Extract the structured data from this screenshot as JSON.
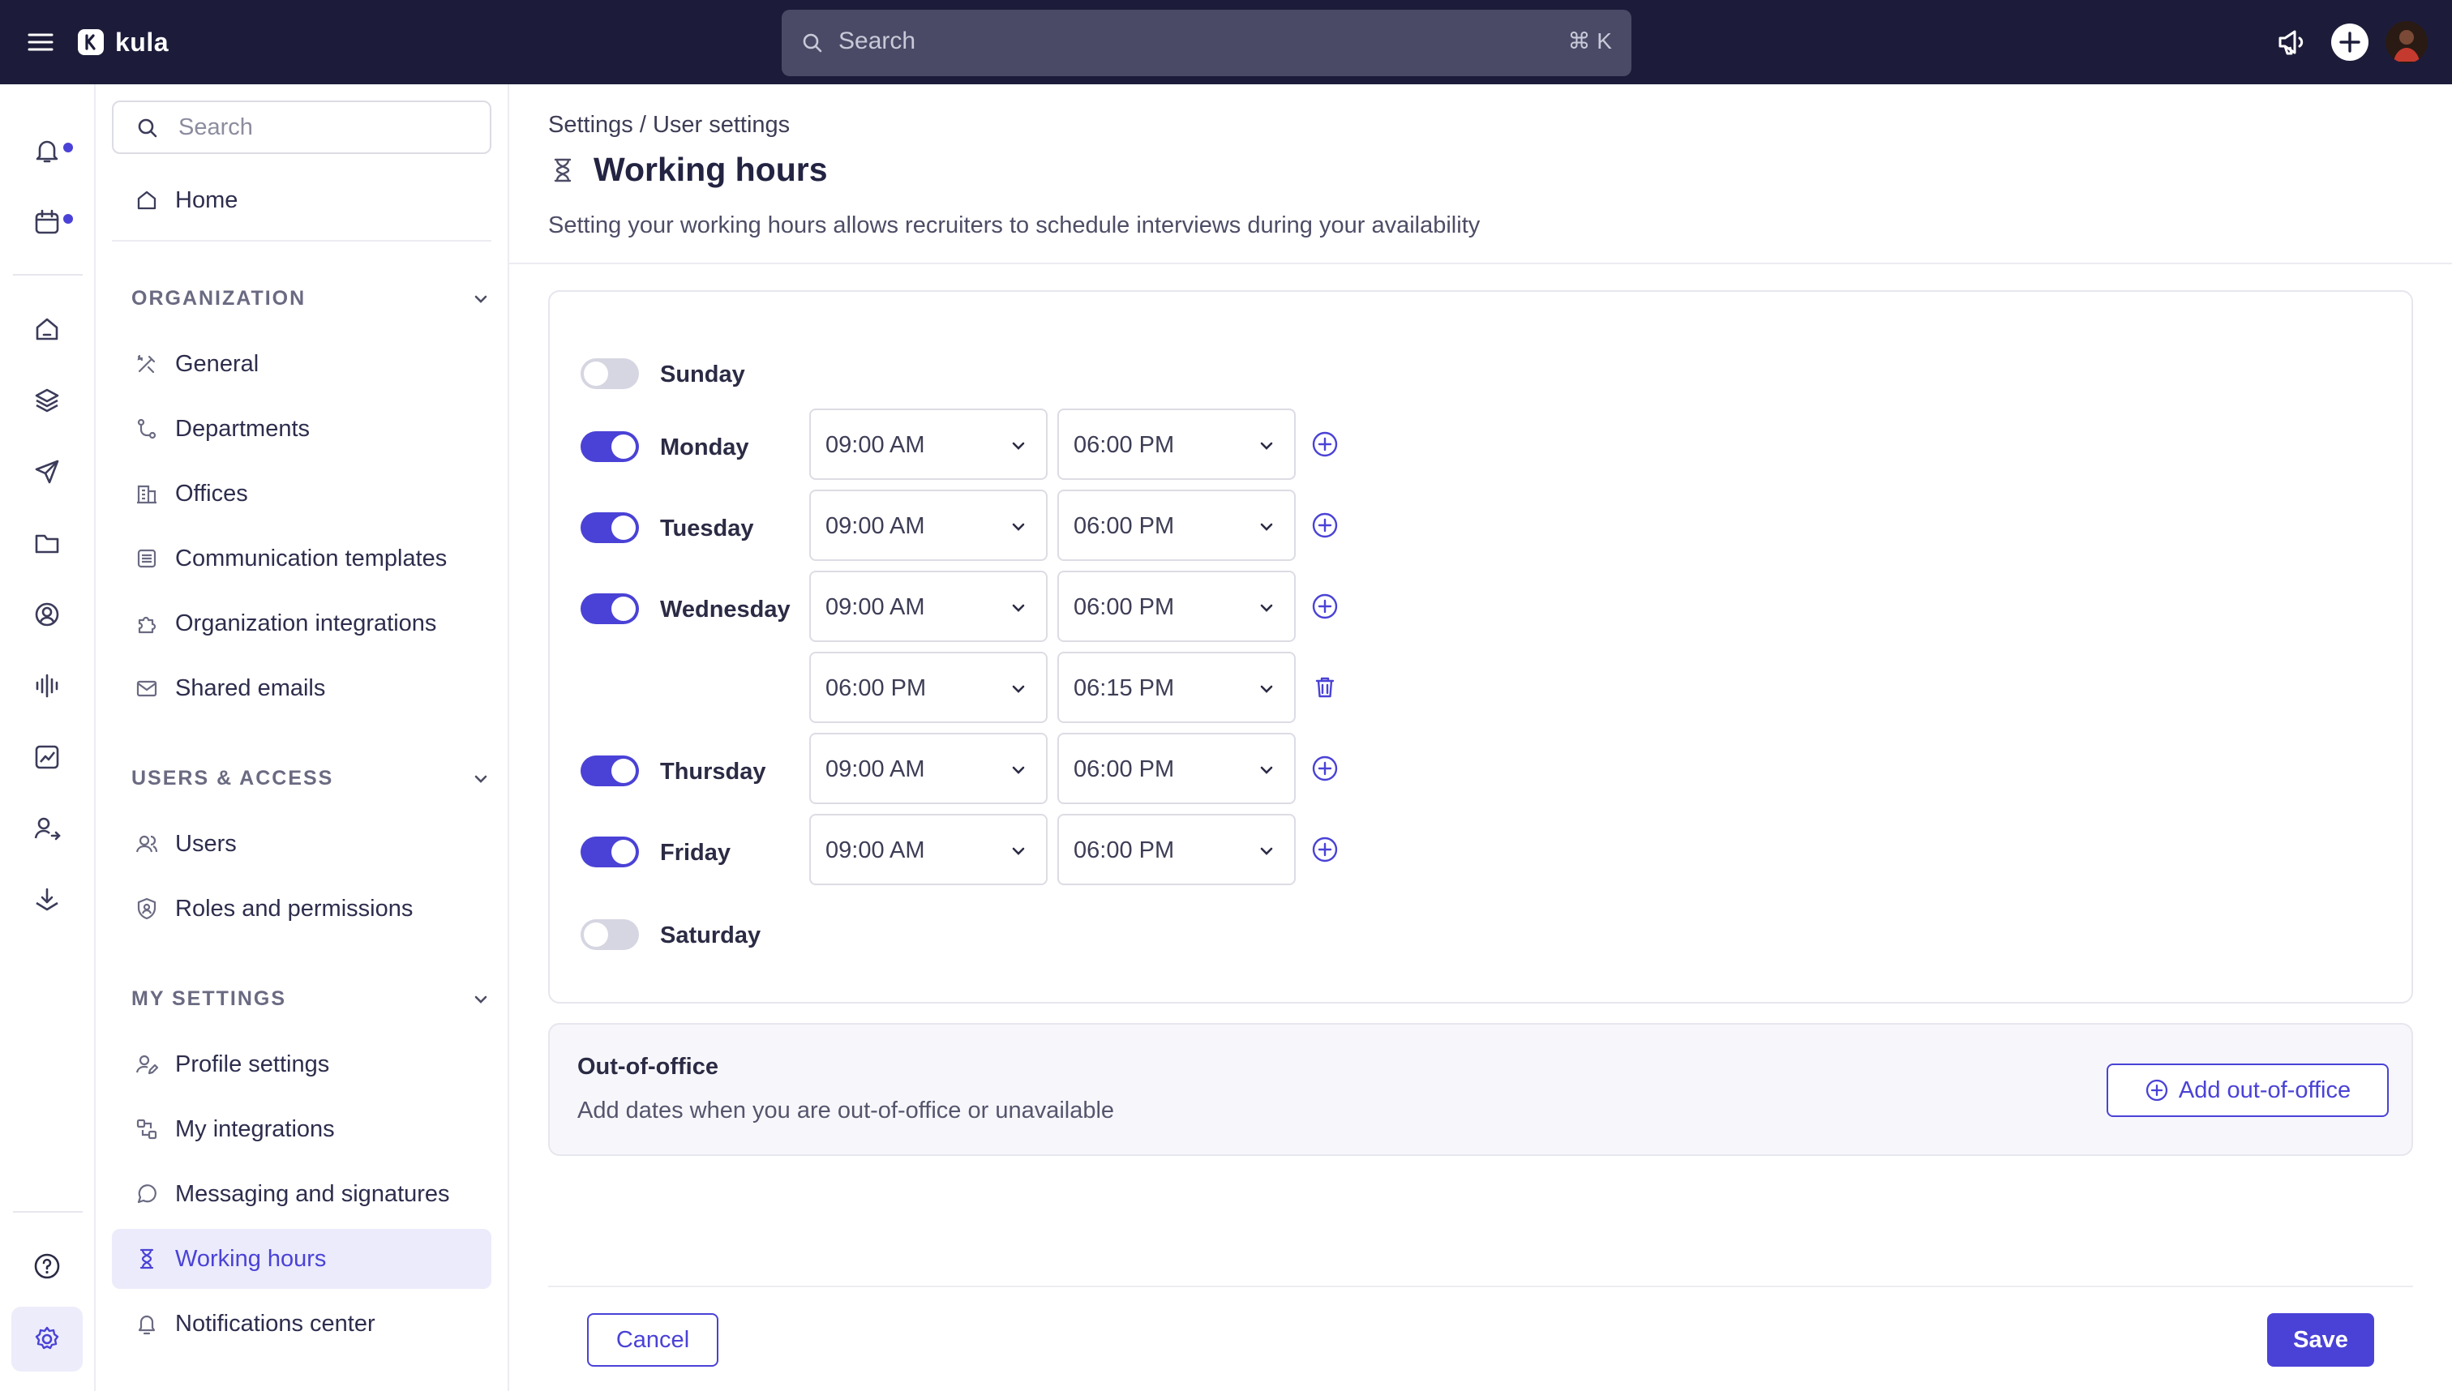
{
  "app": {
    "name": "kula"
  },
  "topbar": {
    "search_placeholder": "Search",
    "search_shortcut": "⌘ K"
  },
  "colors": {
    "accent": "#4a42d6",
    "topbar": "#1c1c3a",
    "active_bg": "#ebebfb"
  },
  "rail": {
    "icons": [
      "bell-icon",
      "calendar-icon",
      "home-icon",
      "layers-icon",
      "send-icon",
      "folder-icon",
      "user-circle-icon",
      "audio-wave-icon",
      "chart-icon",
      "users-arrow-icon",
      "download-icon",
      "help-icon",
      "gear-icon"
    ]
  },
  "sidebar": {
    "search_placeholder": "Search",
    "home": "Home",
    "sections": [
      {
        "title": "ORGANIZATION",
        "items": [
          "General",
          "Departments",
          "Offices",
          "Communication templates",
          "Organization integrations",
          "Shared emails"
        ]
      },
      {
        "title": "USERS & ACCESS",
        "items": [
          "Users",
          "Roles and permissions"
        ]
      },
      {
        "title": "MY SETTINGS",
        "items": [
          "Profile settings",
          "My integrations",
          "Messaging and signatures",
          "Working hours",
          "Notifications center"
        ]
      }
    ],
    "active_item": "Working hours"
  },
  "page": {
    "breadcrumb": "Settings / User settings",
    "title": "Working hours",
    "subtitle": "Setting your working hours allows recruiters to schedule interviews during your availability"
  },
  "schedule": [
    {
      "day": "Sunday",
      "enabled": false,
      "slots": []
    },
    {
      "day": "Monday",
      "enabled": true,
      "slots": [
        {
          "start": "09:00 AM",
          "end": "06:00 PM"
        }
      ]
    },
    {
      "day": "Tuesday",
      "enabled": true,
      "slots": [
        {
          "start": "09:00 AM",
          "end": "06:00 PM"
        }
      ]
    },
    {
      "day": "Wednesday",
      "enabled": true,
      "slots": [
        {
          "start": "09:00 AM",
          "end": "06:00 PM"
        },
        {
          "start": "06:00 PM",
          "end": "06:15 PM"
        }
      ]
    },
    {
      "day": "Thursday",
      "enabled": true,
      "slots": [
        {
          "start": "09:00 AM",
          "end": "06:00 PM"
        }
      ]
    },
    {
      "day": "Friday",
      "enabled": true,
      "slots": [
        {
          "start": "09:00 AM",
          "end": "06:00 PM"
        }
      ]
    },
    {
      "day": "Saturday",
      "enabled": false,
      "slots": []
    }
  ],
  "out_of_office": {
    "title": "Out-of-office",
    "description": "Add dates when you are out-of-office or unavailable",
    "button": "Add out-of-office"
  },
  "footer": {
    "cancel": "Cancel",
    "save": "Save"
  }
}
